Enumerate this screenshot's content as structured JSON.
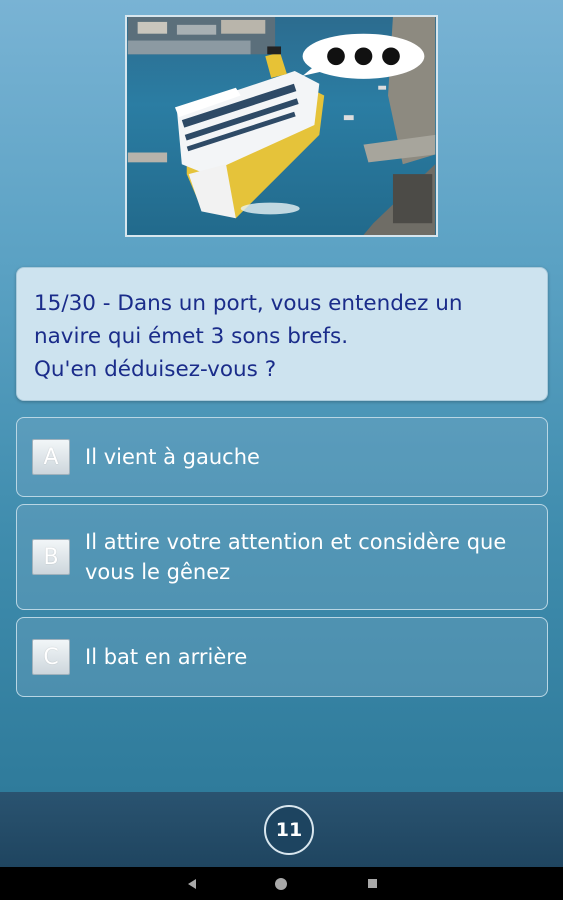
{
  "question": {
    "text": "15/30 - Dans un port, vous entendez un\nnavire qui émet 3 sons brefs.\nQu'en déduisez-vous ?"
  },
  "answers": [
    {
      "letter": "A",
      "text": "Il vient à gauche"
    },
    {
      "letter": "B",
      "text": "Il attire votre attention et considère que vous le gênez"
    },
    {
      "letter": "C",
      "text": "Il bat en arrière"
    }
  ],
  "footer": {
    "counter": "11"
  },
  "colors": {
    "question_text": "#1a2c8a",
    "question_bg": "#cde3ef",
    "answer_text": "#ffffff",
    "bottom_bar": "#1f4560"
  },
  "icons": {
    "nav_back": "triangle-back-icon",
    "nav_home": "circle-home-icon",
    "nav_recents": "square-recents-icon",
    "sound_signal": "three-dots-speech-bubble-icon"
  }
}
